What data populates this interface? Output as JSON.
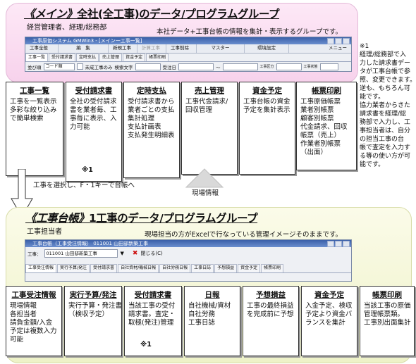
{
  "top": {
    "title_bracket": "《メイン》",
    "title_rest": "全社(全工事)のデータ/プログラムグループ",
    "subtitle": "経営管理者、経理/総務部",
    "description": "本社データ+工事台帳の情報を集計・表示するグループです。",
    "window": {
      "title": "工事原価システム GMWin3 - [メイン一工事一覧]",
      "menu": [
        "工事全般",
        "編　集",
        "新規工事",
        "計算工事",
        "工事削除",
        "マスター",
        "環境設定",
        "メニュー"
      ],
      "tabs": [
        "工事一覧",
        "受付請求書",
        "定時支払",
        "売上管理",
        "資金予定",
        "帳票印刷"
      ],
      "filter_sort_label": "並び順",
      "filter_sort_value": "コード順",
      "filter_checkbox": "未成工事のみ",
      "filter_keyword_label": "検索文字",
      "filter_date_label": "受注日",
      "filter_range_sep": "〜",
      "filter_extra1": "工事区分",
      "filter_extra2": "工事状態"
    },
    "boxes": [
      {
        "head": "工事一覧",
        "lines": [
          "工事を一覧表示",
          "多彩な絞り込み",
          "で簡単検索"
        ],
        "note": ""
      },
      {
        "head": "受付請求書",
        "lines": [
          "全社の受付請求",
          "書を業者毎、工",
          "事毎に表示、入",
          "力可能"
        ],
        "note": "※1"
      },
      {
        "head": "定時支払",
        "lines": [
          "受付請求書から",
          "業者ごとの支払",
          "集計処理",
          "支払計画表",
          "支払発生明細表"
        ],
        "note": ""
      },
      {
        "head": "売上管理",
        "lines": [
          "工事代金請求/",
          "回収管理"
        ],
        "note": ""
      },
      {
        "head": "資金予定",
        "lines": [
          "工事台帳の資金",
          "予定を集計表示"
        ],
        "note": ""
      },
      {
        "head": "帳票印刷",
        "lines": [
          "工事原価帳票",
          "業者別帳票",
          "顧客別帳票",
          "代金請求、回収",
          "帳票（売上）",
          "作業者別帳票",
          "（出面）"
        ],
        "note": ""
      }
    ]
  },
  "side_note": [
    "※1",
    "経理/総務部で入",
    "力した請求書デー",
    "タが工事台帳で参",
    "照、変更できます。",
    "逆も、もちろん可",
    "能です。",
    "協力業者からきた",
    "請求書を経理/総",
    "務部で入力し、工",
    "事担当者は、自分",
    "の担当工事の台",
    "帳で査定を入力す",
    "る等の使い方が可",
    "能です。"
  ],
  "arrow_left_label": "工事を選択し、F・1キーで台帳へ",
  "arrow_right_label": "現場情報",
  "bottom": {
    "title_bracket": "《工事台帳》",
    "title_rest": "1工事のデータ/プログラムグループ",
    "subtitle": "工事担当者",
    "description": "現場担当の方がExcelで行なっている管理イメージそのままです。",
    "window": {
      "title": "工事台帳（工事受注情報） 011001 山田邸新築工事",
      "field_label": "工事：",
      "field_value": "011001 山田邸新築工事",
      "close_label": "閉じる(C)",
      "tabs": [
        "工事受注情報",
        "実行予算/発注",
        "受付請求書",
        "自社資材/機械日報",
        "自社労務日報",
        "工事日誌",
        "予想損益",
        "資金予定",
        "帳票印刷"
      ]
    },
    "boxes": [
      {
        "head": "工事受注情報",
        "lines": [
          "現場情報",
          "各担当者",
          "請負金額/入金",
          "予定は複数入力",
          "可能"
        ],
        "note": ""
      },
      {
        "head": "実行予算/発注",
        "lines": [
          "実行予算・発注書",
          "（検収予定）"
        ],
        "note": ""
      },
      {
        "head": "受付請求書",
        "lines": [
          "当該工事の受付",
          "請求書。査定・",
          "取極(発注)管理"
        ],
        "note": "※1"
      },
      {
        "head": "日報",
        "lines": [
          "自社機械/資材",
          "自社労務",
          "工事日誌"
        ],
        "note": ""
      },
      {
        "head": "予想損益",
        "lines": [
          "工事の最終損益",
          "を完成前に予想"
        ],
        "note": ""
      },
      {
        "head": "資金予定",
        "lines": [
          "入金予定、検収",
          "予定より資金バ",
          "ランスを集計"
        ],
        "note": ""
      },
      {
        "head": "帳票印刷",
        "lines": [
          "当該工事の原価",
          "管理帳票類。",
          "工事別出面集計"
        ],
        "note": ""
      }
    ]
  }
}
